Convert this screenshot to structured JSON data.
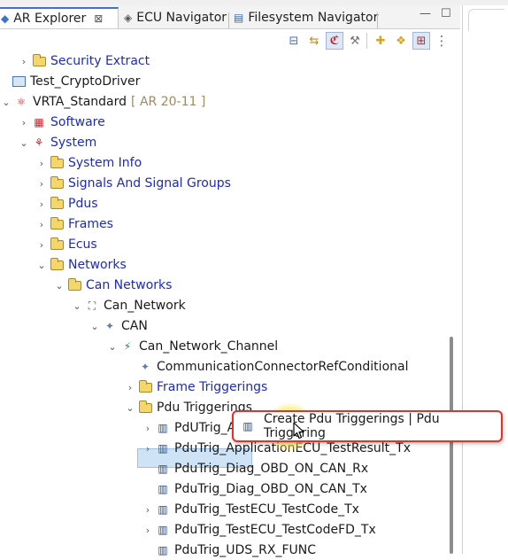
{
  "tabs": [
    {
      "label": "AR Explorer",
      "icon": "ar-explorer-icon",
      "active": true,
      "closable": true
    },
    {
      "label": "ECU Navigator",
      "icon": "ecu-navigator-icon",
      "active": false
    },
    {
      "label": "Filesystem Navigator",
      "icon": "filesystem-navigator-icon",
      "active": false
    }
  ],
  "window_buttons": {
    "minimize": "—",
    "maximize": "☐"
  },
  "toolbar_icons": [
    "collapse-all-icon",
    "link-with-editor-icon",
    "filter-icon",
    "tools-icon",
    "add-element-icon",
    "add-package-icon",
    "grid-view-icon",
    "view-menu-icon"
  ],
  "tree": {
    "nodes": [
      {
        "label": "Security Extract",
        "expander": "collapsed",
        "icon": "folder-icon",
        "style": "blue"
      },
      {
        "label": "Test_CryptoDriver",
        "expander": "none",
        "icon": "project-icon",
        "style": "dark"
      },
      {
        "label": "VRTA_Standard",
        "suffix": "[ AR 20-11 ]",
        "expander": "expanded",
        "icon": "ar-project-icon",
        "style": "dark"
      },
      {
        "label": "Software",
        "expander": "collapsed",
        "icon": "software-icon",
        "style": "blue"
      },
      {
        "label": "System",
        "expander": "expanded",
        "icon": "system-icon",
        "style": "blue"
      },
      {
        "label": "System Info",
        "expander": "collapsed",
        "icon": "folder-icon",
        "style": "blue"
      },
      {
        "label": "Signals And Signal Groups",
        "expander": "collapsed",
        "icon": "folder-icon",
        "style": "blue"
      },
      {
        "label": "Pdus",
        "expander": "collapsed",
        "icon": "folder-icon",
        "style": "blue"
      },
      {
        "label": "Frames",
        "expander": "collapsed",
        "icon": "folder-icon",
        "style": "blue"
      },
      {
        "label": "Ecus",
        "expander": "collapsed",
        "icon": "folder-icon",
        "style": "blue"
      },
      {
        "label": "Networks",
        "expander": "expanded",
        "icon": "folder-icon",
        "style": "blue"
      },
      {
        "label": "Can Networks",
        "expander": "expanded",
        "icon": "folder-icon",
        "style": "blue"
      },
      {
        "label": "Can_Network",
        "expander": "expanded",
        "icon": "network-icon",
        "style": "dark"
      },
      {
        "label": "CAN",
        "expander": "expanded",
        "icon": "element-icon",
        "style": "dark"
      },
      {
        "label": "Can_Network_Channel",
        "expander": "expanded",
        "icon": "channel-icon",
        "style": "dark"
      },
      {
        "label": "CommunicationConnectorRefConditional",
        "expander": "none",
        "icon": "element-icon",
        "style": "dark"
      },
      {
        "label": "Frame Triggerings",
        "expander": "collapsed",
        "icon": "folder-icon",
        "style": "blue"
      },
      {
        "label": "Pdu Triggerings",
        "expander": "expanded",
        "icon": "folder-icon",
        "style": "dark",
        "selected": true
      },
      {
        "label": "PdUTrig_A",
        "expander": "collapsed",
        "icon": "pdu-triggering-icon",
        "style": "dark"
      },
      {
        "label": "PduTrig_ApplicationECU_TestResult_Tx",
        "expander": "collapsed",
        "icon": "pdu-triggering-icon",
        "style": "dark"
      },
      {
        "label": "PduTrig_Diag_OBD_ON_CAN_Rx",
        "expander": "none",
        "icon": "pdu-triggering-icon",
        "style": "dark"
      },
      {
        "label": "PduTrig_Diag_OBD_ON_CAN_Tx",
        "expander": "none",
        "icon": "pdu-triggering-icon",
        "style": "dark"
      },
      {
        "label": "PduTrig_TestECU_TestCode_Tx",
        "expander": "collapsed",
        "icon": "pdu-triggering-icon",
        "style": "dark"
      },
      {
        "label": "PduTrig_TestECU_TestCodeFD_Tx",
        "expander": "collapsed",
        "icon": "pdu-triggering-icon",
        "style": "dark"
      },
      {
        "label": "PduTrig_UDS_RX_FUNC",
        "expander": "none",
        "icon": "pdu-triggering-icon",
        "style": "dark"
      }
    ]
  },
  "popup": {
    "label": "Create Pdu Triggerings | Pdu Triggering",
    "icon": "pdu-triggering-icon"
  },
  "colors": {
    "link_blue": "#1e2bb8",
    "popup_border": "#e5312c",
    "selection": "#cfe3f7",
    "ar_version": "#a08a5a"
  }
}
